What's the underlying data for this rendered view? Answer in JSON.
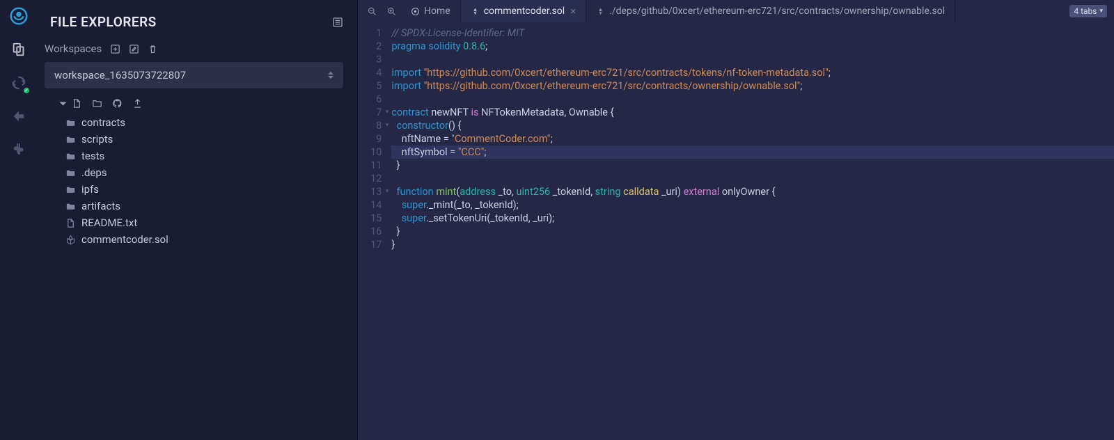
{
  "panel": {
    "title": "FILE EXPLORERS",
    "workspaces_label": "Workspaces",
    "workspace_selected": "workspace_1635073722807"
  },
  "tree": [
    {
      "type": "folder",
      "label": "contracts"
    },
    {
      "type": "folder",
      "label": "scripts"
    },
    {
      "type": "folder",
      "label": "tests"
    },
    {
      "type": "folder",
      "label": ".deps"
    },
    {
      "type": "folder",
      "label": "ipfs"
    },
    {
      "type": "folder",
      "label": "artifacts"
    },
    {
      "type": "file",
      "label": "README.txt"
    },
    {
      "type": "sol",
      "label": "commentcoder.sol"
    }
  ],
  "tabs": {
    "home": "Home",
    "active": "commentcoder.sol",
    "other": "./deps/github/0xcert/ethereum-erc721/src/contracts/ownership/ownable.sol",
    "count": "4 tabs"
  },
  "code": {
    "l1": "// SPDX-License-Identifier: MIT",
    "l2a": "pragma",
    "l2b": "solidity",
    "l2c": "0.8.6",
    "l2d": ";",
    "l4a": "import",
    "l4b": "\"https://github.com/0xcert/ethereum-erc721/src/contracts/tokens/nf-token-metadata.sol\"",
    "l4c": ";",
    "l5a": "import",
    "l5b": "\"https://github.com/0xcert/ethereum-erc721/src/contracts/ownership/ownable.sol\"",
    "l5c": ";",
    "l7a": "contract",
    "l7b": "newNFT",
    "l7c": "is",
    "l7d": "NFTokenMetadata, Ownable {",
    "l8a": "constructor",
    "l8b": "() {",
    "l9a": "nftName = ",
    "l9b": "\"CommentCoder.com\"",
    "l9c": ";",
    "l10a": "nftSymbol = ",
    "l10b": "\"CCC\"",
    "l10c": ";",
    "l11": "  }",
    "l13a": "function",
    "l13b": "mint",
    "l13c": "(",
    "l13d": "address",
    "l13e": "_to, ",
    "l13f": "uint256",
    "l13g": "_tokenId, ",
    "l13h": "string",
    "l13i": "calldata",
    "l13j": "_uri) ",
    "l13k": "external",
    "l13l": "onlyOwner {",
    "l14a": "super",
    "l14b": "._mint(_to, _tokenId);",
    "l15a": "super",
    "l15b": "._setTokenUri(_tokenId, _uri);",
    "l16": "  }",
    "l17": "}"
  }
}
